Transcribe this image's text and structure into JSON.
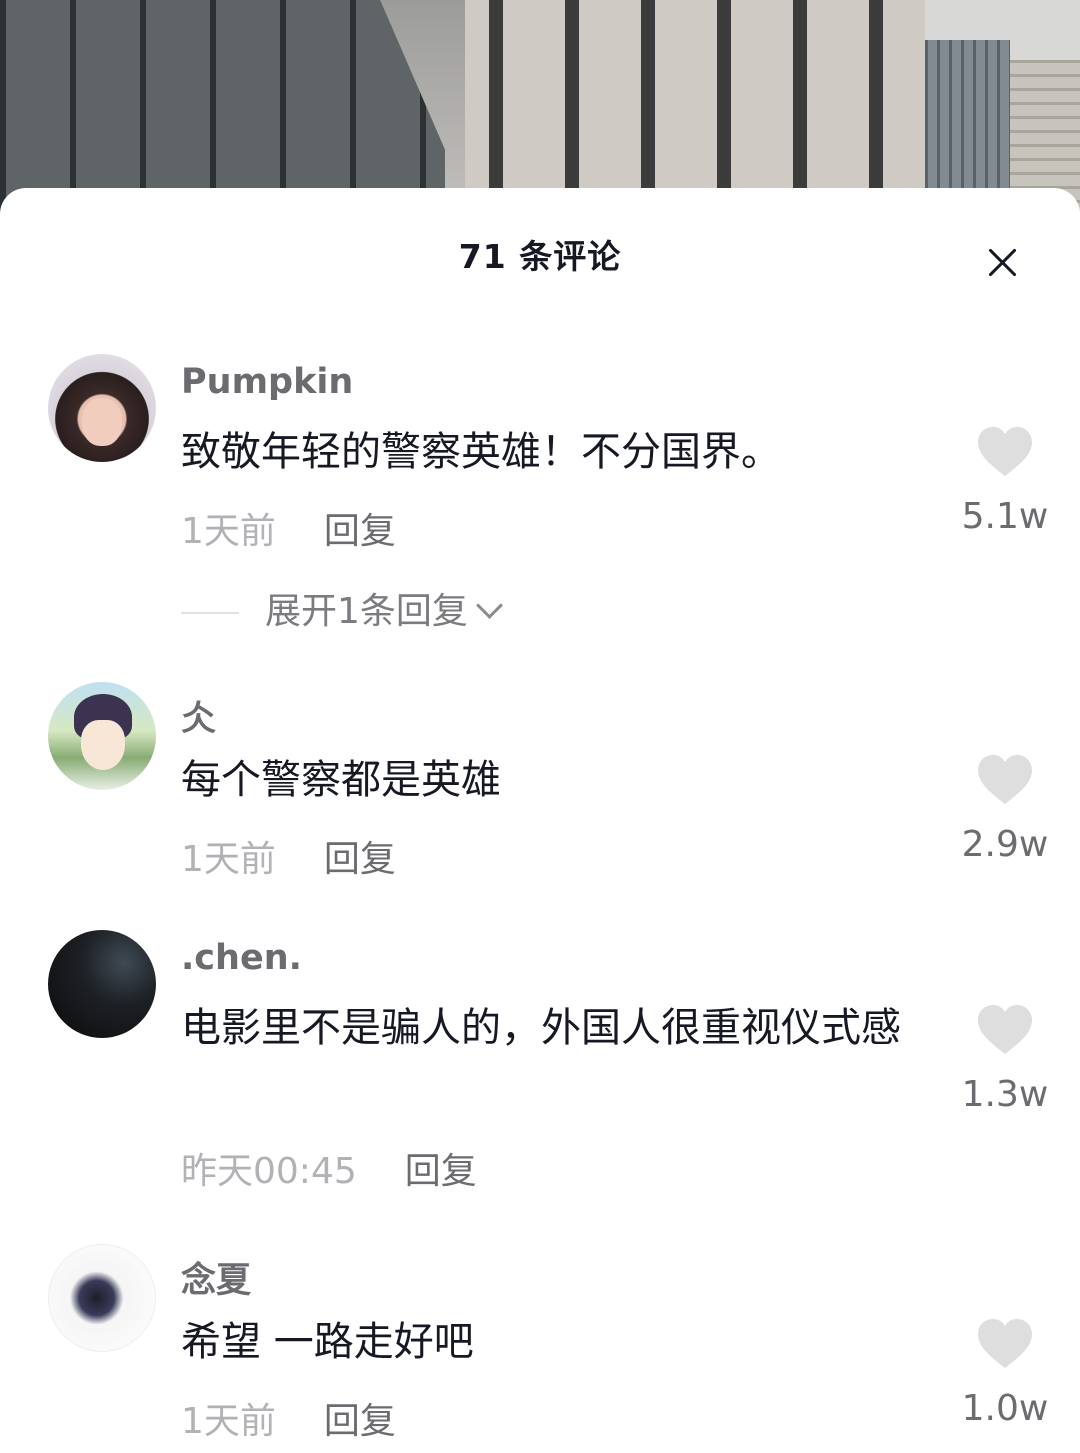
{
  "header": {
    "title": "71 条评论"
  },
  "icons": {
    "close": "close-icon",
    "like": "heart-icon",
    "expand": "chevron-down-icon"
  },
  "colors": {
    "text_primary": "#161823",
    "text_secondary": "#6b6b70",
    "text_muted": "#b2b2b6",
    "heart": "#dedede"
  },
  "comments": [
    {
      "username": "Pumpkin",
      "text": "致敬年轻的警察英雄！不分国界。",
      "time": "1天前",
      "reply_label": "回复",
      "likes": "5.1w",
      "expand_label": "展开1条回复"
    },
    {
      "username": "仌",
      "text": "每个警察都是英雄",
      "time": "1天前",
      "reply_label": "回复",
      "likes": "2.9w"
    },
    {
      "username": ".chen.",
      "text": "电影里不是骗人的，外国人很重视仪式感",
      "time": "昨天00:45",
      "reply_label": "回复",
      "likes": "1.3w"
    },
    {
      "username": "念夏",
      "text": "希望 一路走好吧",
      "time": "1天前",
      "reply_label": "回复",
      "likes": "1.0w"
    }
  ]
}
